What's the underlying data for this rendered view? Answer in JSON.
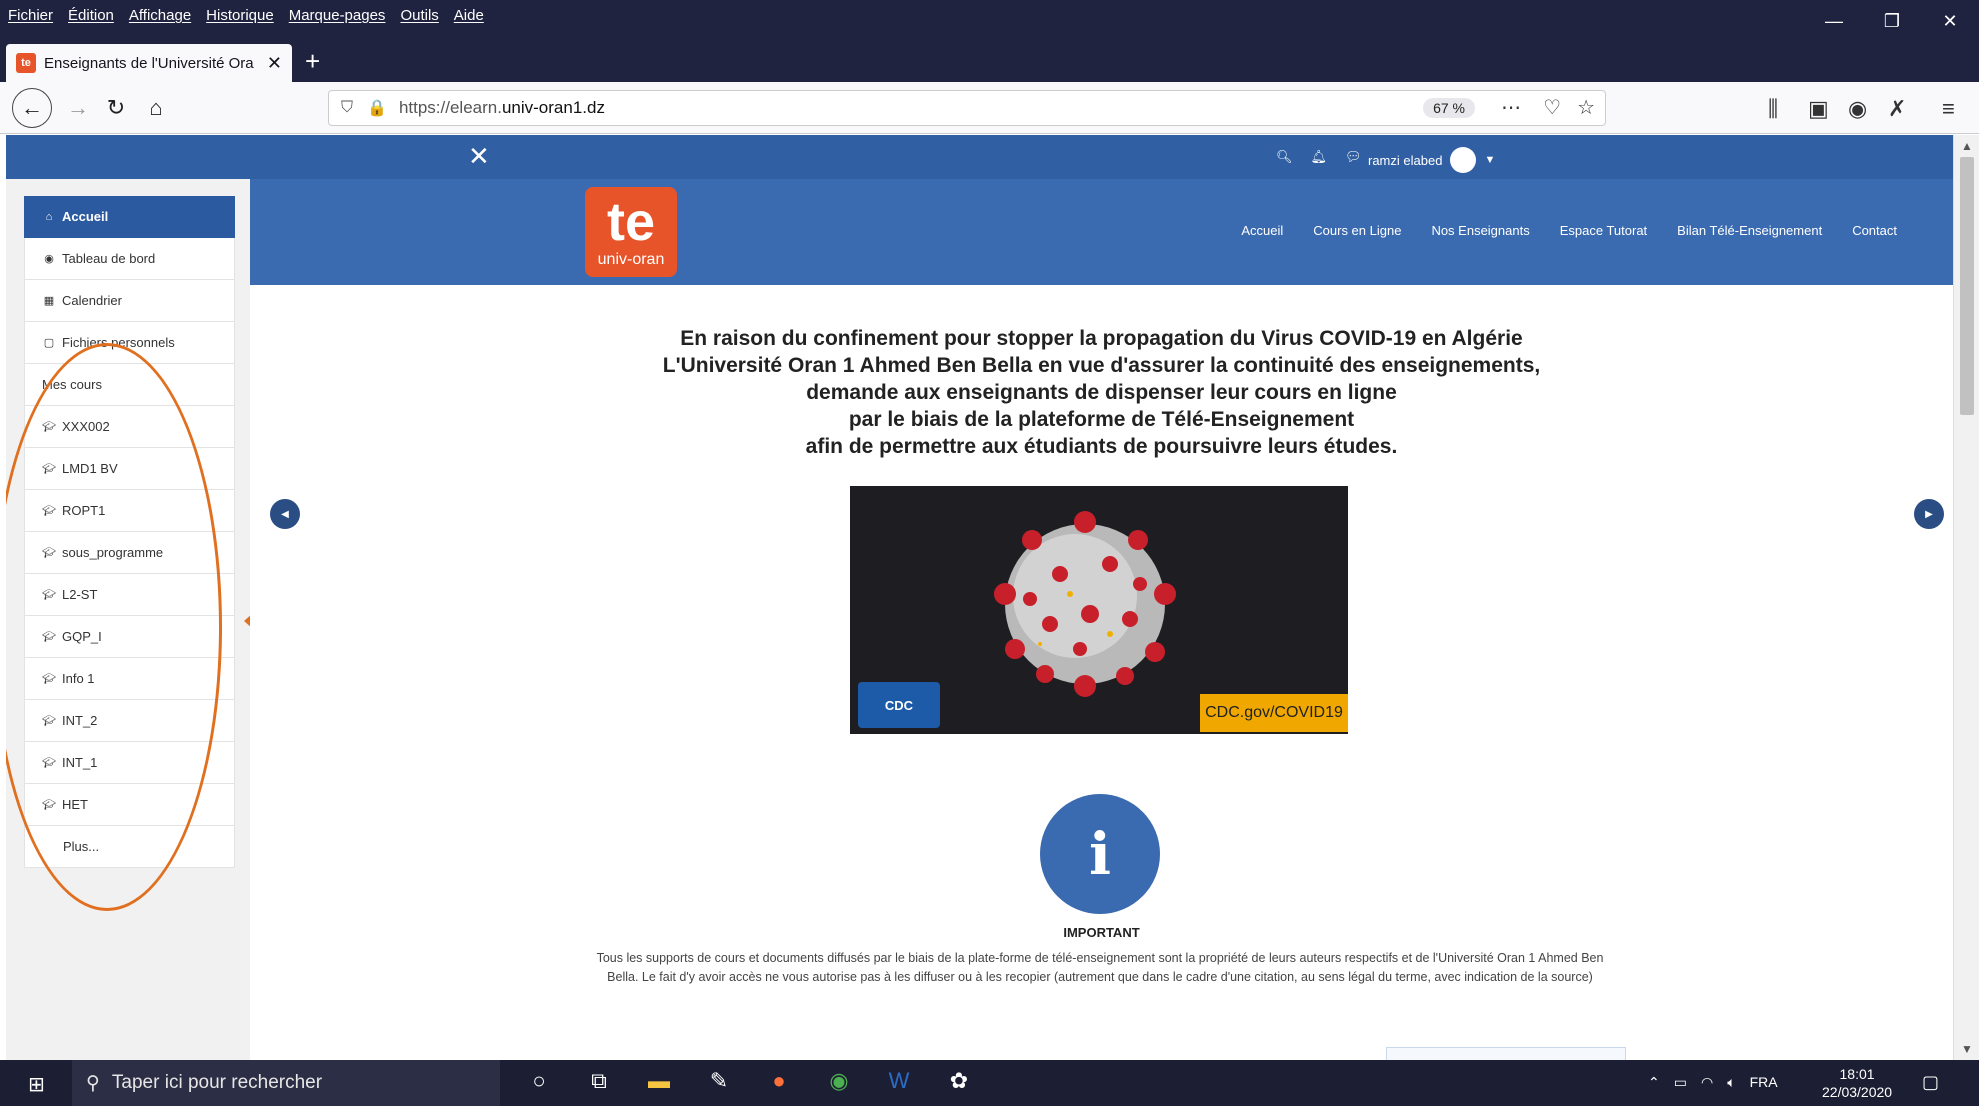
{
  "browser": {
    "menu": [
      "Fichier",
      "Édition",
      "Affichage",
      "Historique",
      "Marque-pages",
      "Outils",
      "Aide"
    ],
    "tab_title": "Enseignants de l'Université Ora",
    "url_scheme": "https://elearn.",
    "url_host": "univ-oran1.dz",
    "zoom": "67 %"
  },
  "topnav": {
    "user_name": "ramzi elabed"
  },
  "sidebar": {
    "items": [
      {
        "label": "Accueil",
        "icon": "home-icon"
      },
      {
        "label": "Tableau de bord",
        "icon": "dashboard-icon"
      },
      {
        "label": "Calendrier",
        "icon": "calendar-icon"
      },
      {
        "label": "Fichiers personnels",
        "icon": "file-icon"
      }
    ],
    "section_title": "Mes cours",
    "courses": [
      "XXX002",
      "LMD1 BV",
      "ROPT1",
      "sous_programme",
      "L2-ST",
      "GQP_I",
      "Info 1",
      "INT_2",
      "INT_1",
      "HET"
    ],
    "more_label": "Plus..."
  },
  "site": {
    "logo_big": "te",
    "logo_small": "univ-oran",
    "menu": [
      "Accueil",
      "Cours en Ligne",
      "Nos Enseignants",
      "Espace Tutorat",
      "Bilan Télé-Enseignement",
      "Contact"
    ],
    "headline": [
      "En raison du confinement pour stopper la propagation du Virus COVID-19 en Algérie",
      "L'Université Oran 1 Ahmed Ben Bella en vue d'assurer la continuité des enseignements,",
      "demande aux enseignants de dispenser leur cours en ligne",
      "par le biais de la plateforme de Télé-Enseignement",
      "afin de permettre aux étudiants de poursuivre leurs études."
    ],
    "image_badge": "CDC",
    "image_link": "CDC.gov/COVID19",
    "info_symbol": "i",
    "important_title": "IMPORTANT",
    "notice": "Tous les supports de cours et documents diffusés par le biais de la plate-forme de télé-enseignement sont la propriété de leurs auteurs respectifs et de l'Université Oran 1 Ahmed Ben Bella. Le fait d'y avoir accès ne vous autorise pas à les diffuser ou à les recopier (autrement que dans le cadre d'une citation, au sens légal du terme, avec indication de la source)"
  },
  "taskbar": {
    "search_placeholder": "Taper ici pour rechercher",
    "lang": "FRA",
    "time": "18:01",
    "date": "22/03/2020"
  },
  "colors": {
    "brand_blue": "#3060a3",
    "accent_orange": "#e8542a",
    "annotation": "#e07020"
  }
}
